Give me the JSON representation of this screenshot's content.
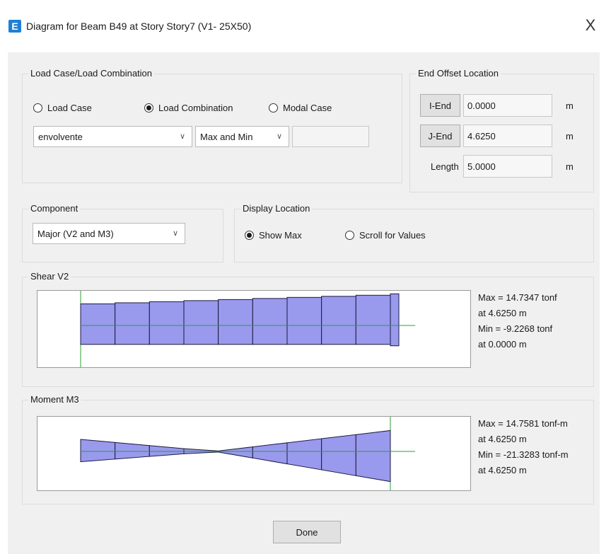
{
  "window": {
    "title": "Diagram for Beam B49 at Story Story7 (V1- 25X50)",
    "icon_letter": "E",
    "close_glyph": "X"
  },
  "load_case": {
    "group_label": "Load Case/Load Combination",
    "options": [
      {
        "label": "Load Case",
        "selected": false
      },
      {
        "label": "Load Combination",
        "selected": true
      },
      {
        "label": "Modal Case",
        "selected": false
      }
    ],
    "combo_value": "envolvente",
    "type_value": "Max and Min",
    "extra_value": ""
  },
  "end_offset": {
    "group_label": "End Offset Location",
    "i_end_label": "I-End",
    "i_end_value": "0.0000",
    "j_end_label": "J-End",
    "j_end_value": "4.6250",
    "length_label": "Length",
    "length_value": "5.0000",
    "unit": "m"
  },
  "component": {
    "group_label": "Component",
    "value": "Major (V2 and M3)"
  },
  "display_location": {
    "group_label": "Display Location",
    "options": [
      {
        "label": "Show Max",
        "selected": true
      },
      {
        "label": "Scroll for Values",
        "selected": false
      }
    ]
  },
  "shear": {
    "group_label": "Shear V2",
    "max_line": "Max = 14.7347 tonf",
    "max_at": "at 4.6250 m",
    "min_line": "Min = -9.2268 tonf",
    "min_at": "at 0.0000 m",
    "diagram": {
      "x_start": 0.0,
      "x_end": 4.625,
      "top_start": 10.0,
      "top_end": 14.7347,
      "bottom_start": -9.2268,
      "bottom_end": -9.2268,
      "scale_max": 20
    }
  },
  "moment": {
    "group_label": "Moment M3",
    "max_line": "Max = 14.7581 tonf-m",
    "max_at": "at 4.6250 m",
    "min_line": "Min = -21.3283 tonf-m",
    "min_at": "at 4.6250 m",
    "diagram": {
      "x_start": 0.0,
      "x_end": 4.625,
      "top": [
        [
          0,
          8.5
        ],
        [
          2.0,
          0
        ],
        [
          4.625,
          14.7581
        ]
      ],
      "bottom": [
        [
          0,
          -7.3
        ],
        [
          2.0,
          0
        ],
        [
          4.625,
          -21.3283
        ]
      ]
    }
  },
  "footer": {
    "done_label": "Done"
  },
  "colors": {
    "fill": "#9999ee",
    "outline": "#1a1a40",
    "axis": "#2f9e2f",
    "support": "#2f9e2f"
  }
}
